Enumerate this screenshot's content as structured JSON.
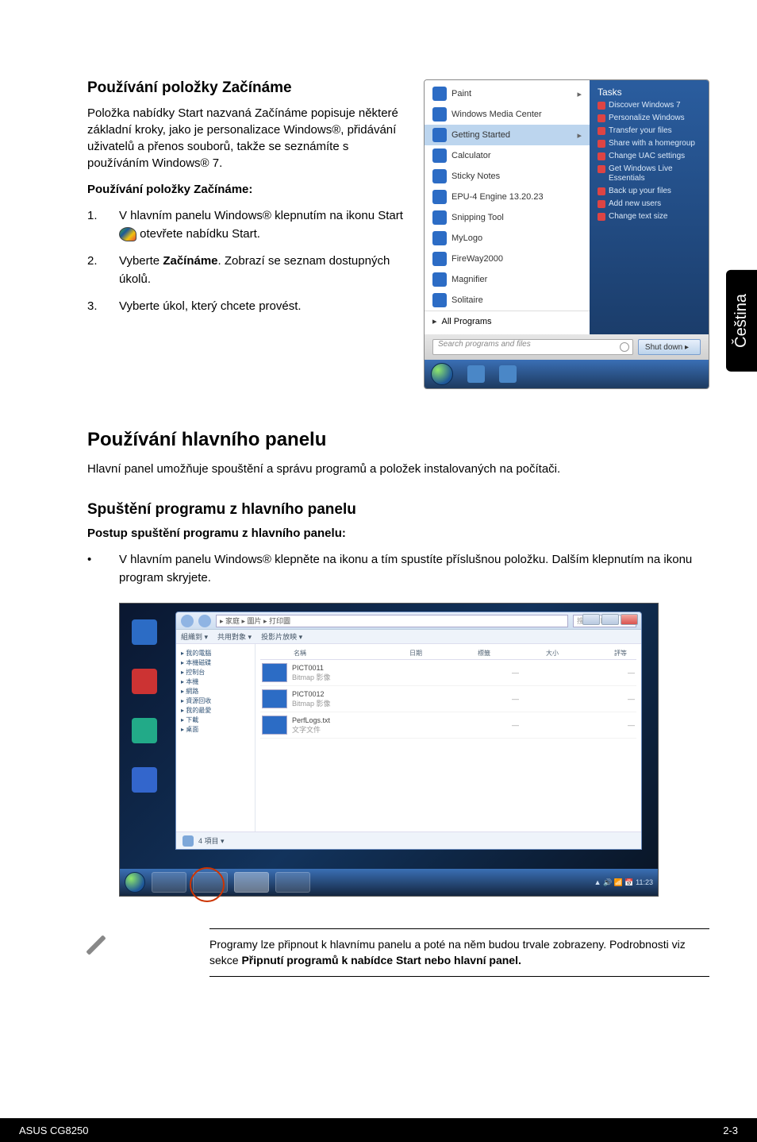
{
  "sideTab": "Čeština",
  "section1": {
    "title": "Používání položky Začínáme",
    "intro": "Položka nabídky Start nazvaná Začínáme popisuje některé základní kroky, jako je personalizace Windows®, přidávání uživatelů a přenos souborů, takže se seznámíte s používáním Windows® 7.",
    "howto_title": "Používání položky Začínáme:",
    "steps": [
      {
        "n": "1.",
        "pre": "V hlavním panelu Windows® klepnutím na ikonu Start ",
        "post": " otevřete nabídku Start."
      },
      {
        "n": "2.",
        "text": "Vyberte Začínáme. Zobrazí se seznam dostupných úkolů.",
        "bold": "Začínáme"
      },
      {
        "n": "3.",
        "text": "Vyberte úkol, který chcete provést."
      }
    ]
  },
  "startMenu": {
    "left": [
      {
        "label": "Paint",
        "arrow": true
      },
      {
        "label": "Windows Media Center"
      },
      {
        "label": "Getting Started",
        "arrow": true,
        "hl": true
      },
      {
        "label": "Calculator"
      },
      {
        "label": "Sticky Notes"
      },
      {
        "label": "EPU-4 Engine 13.20.23"
      },
      {
        "label": "Snipping Tool"
      },
      {
        "label": "MyLogo"
      },
      {
        "label": "FireWay2000"
      },
      {
        "label": "Magnifier"
      },
      {
        "label": "Solitaire"
      }
    ],
    "allPrograms": "All Programs",
    "searchPlaceholder": "Search programs and files",
    "shutdown": "Shut down",
    "tasksTitle": "Tasks",
    "tasks": [
      "Discover Windows 7",
      "Personalize Windows",
      "Transfer your files",
      "Share with a homegroup",
      "Change UAC settings",
      "Get Windows Live Essentials",
      "Back up your files",
      "Add new users",
      "Change text size"
    ]
  },
  "section2": {
    "title": "Používání hlavního panelu",
    "intro": "Hlavní panel umožňuje spouštění a správu programů a položek instalovaných na počítači."
  },
  "section3": {
    "title": "Spuštění programu z hlavního panelu",
    "howto_title": "Postup spuštění programu z hlavního panelu:",
    "bullet": "V hlavním panelu Windows® klepněte na ikonu a tím spustíte příslušnou položku. Dalším klepnutím na ikonu program skryjete."
  },
  "gsWindow": {
    "address": "  ▸  家庭 ▸ 圖片 ▸ 打印圖",
    "toolbar": [
      "組織到 ▾",
      "共用對象 ▾",
      "投影片放映 ▾"
    ],
    "searchHint": "搜尋 打印",
    "navItems": [
      "我的電腦",
      "本機磁碟",
      "控制台",
      "本機",
      "網路",
      "資源回收",
      "我的最愛",
      "下載",
      "桌面"
    ],
    "headers": [
      "名稱",
      "日期",
      "標籤",
      "大小",
      "評等"
    ],
    "rows": [
      {
        "name": "PICT0011",
        "line2": "Bitmap 影像"
      },
      {
        "name": "PICT0012",
        "line2": "Bitmap 影像"
      },
      {
        "name": "PerfLogs.txt",
        "line2": "文字文件"
      }
    ],
    "status": "4 項目 ▾"
  },
  "note": {
    "line1": "Programy lze připnout k hlavnímu panelu a poté na něm budou trvale zobrazeny. Podrobnosti viz sekce ",
    "bold": "Připnutí programů k nabídce Start nebo hlavní panel."
  },
  "footer": {
    "left": "ASUS CG8250",
    "right": "2-3"
  }
}
